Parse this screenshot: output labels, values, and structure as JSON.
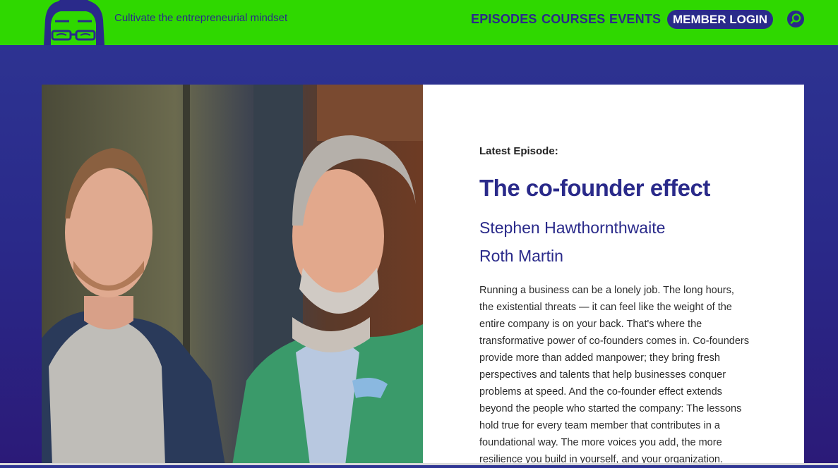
{
  "header": {
    "tagline": "Cultivate the entrepreneurial mindset",
    "nav": [
      "EPISODES",
      "COURSES",
      "EVENTS"
    ],
    "member_login": "MEMBER LOGIN",
    "search_icon": "search-icon",
    "colors": {
      "header_bg": "#2fd800",
      "brand": "#2a2a8a"
    }
  },
  "episode": {
    "label": "Latest Episode:",
    "title": "The co-founder effect",
    "guests": [
      "Stephen Hawthornthwaite",
      "Roth Martin"
    ],
    "description": "Running a business can be a lonely job. The long hours, the existential threats — it can feel like the weight of the entire company is on your back. That's where the transformative power of co-founders comes in. Co-founders provide more than added manpower; they bring fresh perspectives and talents that help businesses conquer problems at speed. And the co-founder effect extends beyond the people who started the company: The lessons hold true for every team member that contributes in a foundational way. The more voices you add, the more resilience you build in yourself, and your organization."
  }
}
